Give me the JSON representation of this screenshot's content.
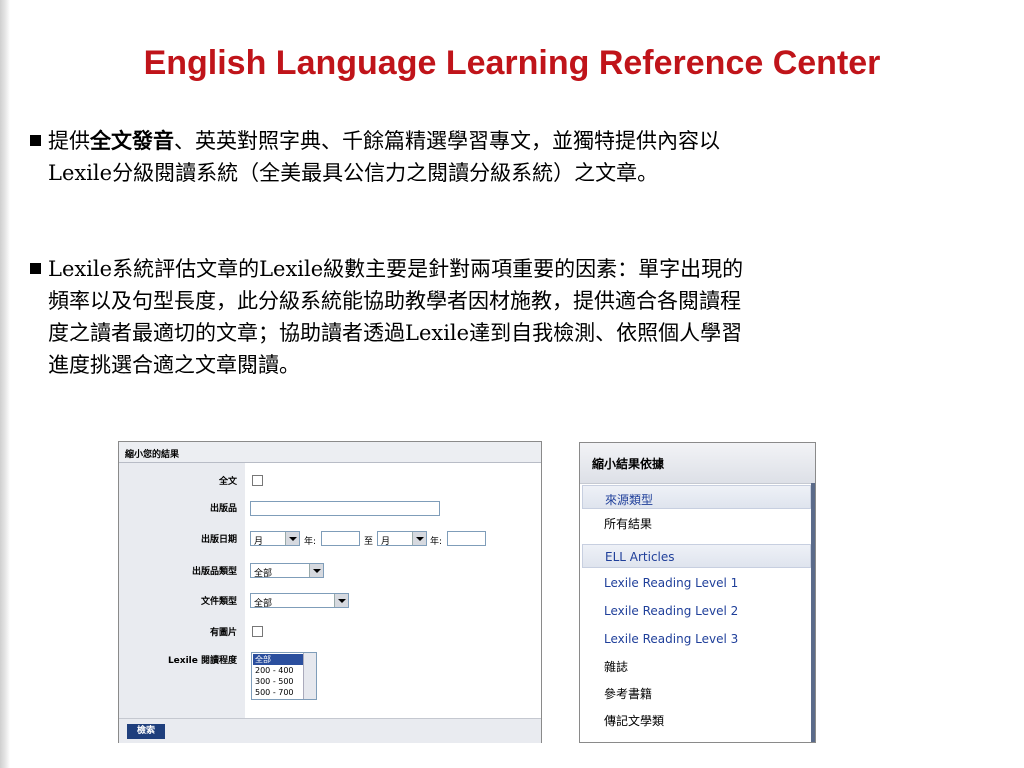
{
  "title": "English Language Learning Reference Center",
  "bullet1": {
    "line1_pre": "提供",
    "line1_bold": "全文發音",
    "line1_post": "、英英對照字典、千餘篇精選學習專文，並獨特提供內容以",
    "line2": "Lexile分級閱讀系統（全美最具公信力之閱讀分級系統）之文章。"
  },
  "bullet2": {
    "line1": "Lexile系統評估文章的Lexile級數主要是針對兩項重要的因素：單字出現的",
    "line2": "頻率以及句型長度，此分級系統能協助教學者因材施教，提供適合各閱讀程",
    "line3": "度之讀者最適切的文章；協助讀者透過Lexile達到自我檢測、依照個人學習",
    "line4": "進度挑選合適之文章閱讀。"
  },
  "filter_panel": {
    "header": "縮小您的結果",
    "fulltext_label": "全文",
    "publication_label": "出版品",
    "pubdate_label": "出版日期",
    "month_from": "月",
    "year_label": "年:",
    "to_label": "至",
    "month_to": "月",
    "year_label2": "年:",
    "pubtype_label": "出版品類型",
    "pubtype_value": "全部",
    "doctype_label": "文件類型",
    "doctype_value": "全部",
    "images_label": "有圖片",
    "lexile_label": "Lexile 閱讀程度",
    "lexile_options": [
      "全部",
      "200 - 400",
      "300 - 500",
      "500 - 700"
    ],
    "search_button": "檢索"
  },
  "refine_panel": {
    "header": "縮小結果依據",
    "section_source": "來源類型",
    "all_results": "所有結果",
    "section_ell": "ELL Articles",
    "items": [
      "Lexile Reading Level 1",
      "Lexile Reading Level 2",
      "Lexile Reading Level 3"
    ],
    "magazines": "雜誌",
    "reference_books": "參考書籍",
    "biographies": "傳記文學類"
  }
}
